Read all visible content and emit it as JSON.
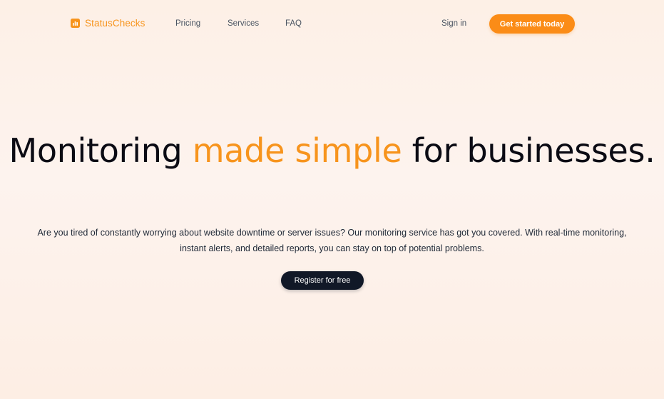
{
  "nav": {
    "brand": {
      "name": "StatusChecks",
      "icon": "bar-chart-icon"
    },
    "links": [
      "Pricing",
      "Services",
      "FAQ"
    ],
    "signin_label": "Sign in",
    "cta_label": "Get started today"
  },
  "hero": {
    "title_part1": "Monitoring ",
    "title_accent": "made simple",
    "title_part2": " for businesses.",
    "description": "Are you tired of constantly worrying about website downtime or server issues? Our monitoring service has got you covered. With real-time monitoring, instant alerts, and detailed reports, you can stay on top of potential problems.",
    "register_label": "Register for free"
  },
  "colors": {
    "accent": "#f7941d",
    "cta_background": "#fb8c17",
    "dark_button": "#111827",
    "heading": "#0b0b14"
  }
}
